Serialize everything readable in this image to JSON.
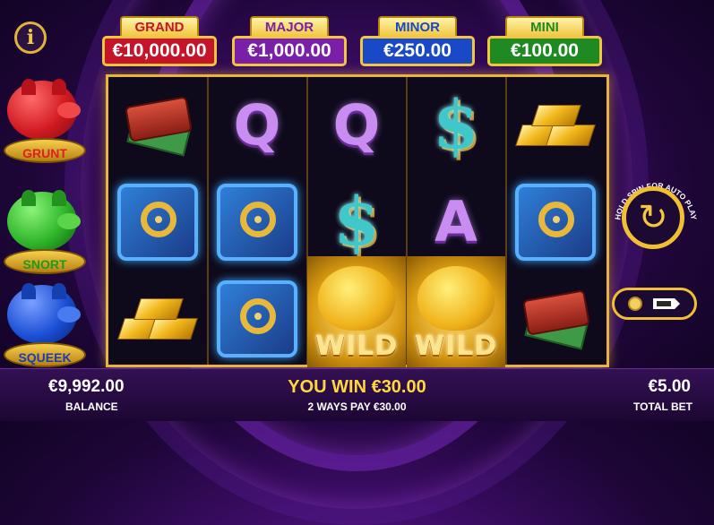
{
  "info_button": {
    "glyph": "i"
  },
  "jackpots": [
    {
      "name": "GRAND",
      "value": "€10,000.00",
      "color": "#c6142a"
    },
    {
      "name": "MAJOR",
      "value": "€1,000.00",
      "color": "#7a1fa8"
    },
    {
      "name": "MINOR",
      "value": "€250.00",
      "color": "#1a49c7"
    },
    {
      "name": "MINI",
      "value": "€100.00",
      "color": "#1f8a22"
    }
  ],
  "piggies": [
    {
      "label": "GRUNT",
      "color": "#d11a22",
      "label_color": "#e02020"
    },
    {
      "label": "SNORT",
      "color": "#2fb52a",
      "label_color": "#1f9a1c"
    },
    {
      "label": "SQUEEK",
      "color": "#1b4fd6",
      "label_color": "#1a3fb5"
    }
  ],
  "reels": [
    [
      "wallet",
      "vault",
      "gold"
    ],
    [
      "Q",
      "vault",
      "vault"
    ],
    [
      "Q",
      "$",
      "WILD"
    ],
    [
      "$",
      "A",
      "WILD"
    ],
    [
      "gold",
      "vault",
      "wallet"
    ]
  ],
  "wild_label": "WILD",
  "autoplay": {
    "label": "HOLD SPIN FOR AUTO PLAY"
  },
  "footer": {
    "balance_value": "€9,992.00",
    "balance_label": "BALANCE",
    "win_text": "YOU WIN €30.00",
    "win_sub": "2 WAYS PAY €30.00",
    "total_bet_value": "€5.00",
    "total_bet_label": "TOTAL BET"
  }
}
